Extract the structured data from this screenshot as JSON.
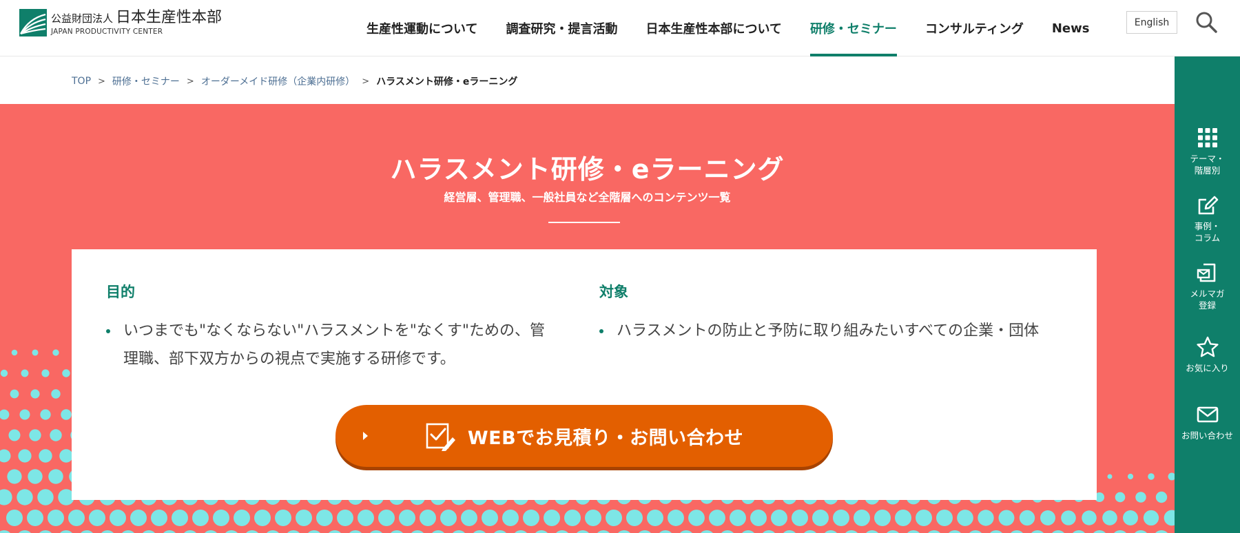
{
  "brand": {
    "org_prefix": "公益財団法人",
    "org_name": "日本生産性本部",
    "org_en": "JAPAN PRODUCTIVITY CENTER"
  },
  "nav": {
    "items": [
      {
        "label": "生産性運動について",
        "active": false
      },
      {
        "label": "調査研究・提言活動",
        "active": false
      },
      {
        "label": "日本生産性本部について",
        "active": false
      },
      {
        "label": "研修・セミナー",
        "active": true
      },
      {
        "label": "コンサルティング",
        "active": false
      },
      {
        "label": "News",
        "active": false
      }
    ],
    "language_button": "English",
    "search_icon": "search-icon"
  },
  "breadcrumb": {
    "items": [
      "TOP",
      "研修・セミナー",
      "オーダーメイド研修（企業内研修）",
      "ハラスメント研修・eラーニング"
    ],
    "separator": ">"
  },
  "hero": {
    "title": "ハラスメント研修・eラーニング",
    "subtitle": "経営層、管理職、一般社員など全階層へのコンテンツ一覧",
    "background_color": "#f96863",
    "dot_color": "#7de6e6"
  },
  "purpose": {
    "heading": "目的",
    "items": [
      "いつまでも\"なくならない\"ハラスメントを\"なくす\"ための、管理職、部下双方からの視点で実施する研修です。"
    ]
  },
  "target": {
    "heading": "対象",
    "items": [
      "ハラスメントの防止と予防に取り組みたいすべての企業・団体"
    ]
  },
  "cta": {
    "label": "WEBでお見積り・お問い合わせ",
    "icon": "checklist-pen-icon",
    "color": "#e35f00"
  },
  "sidebar": {
    "color": "#0f7f6a",
    "items": [
      {
        "label": "テーマ・\n階層別",
        "icon": "grid-icon"
      },
      {
        "label": "事例・\nコラム",
        "icon": "edit-icon"
      },
      {
        "label": "メルマガ\n登録",
        "icon": "mail-sign-up-icon"
      },
      {
        "label": "お気に入り",
        "icon": "star-icon"
      },
      {
        "label": "お問い合わせ",
        "icon": "envelope-icon"
      }
    ]
  }
}
